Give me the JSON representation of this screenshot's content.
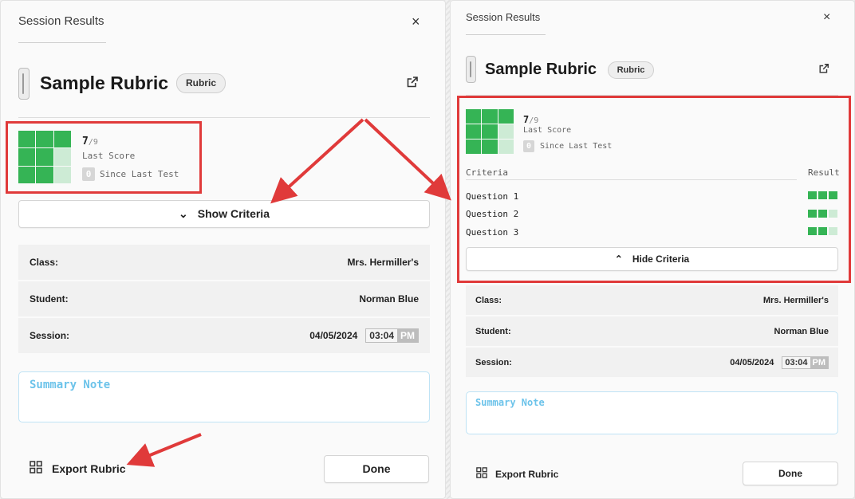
{
  "colors": {
    "green": "#35b455",
    "green_light": "#cdebd5",
    "annotation": "#e03a3a",
    "note_border": "#bfe3f5"
  },
  "left": {
    "header": {
      "title": "Session Results",
      "close_icon": "×"
    },
    "rubric": {
      "title": "Sample Rubric",
      "badge": "Rubric",
      "link_icon": "external-link-icon"
    },
    "score": {
      "value": "7",
      "max": "/9",
      "label": "Last Score",
      "since_value": "0",
      "since_label": "Since Last Test",
      "grid": [
        1,
        1,
        1,
        1,
        1,
        0,
        1,
        1,
        0
      ]
    },
    "show_criteria": {
      "icon": "⌄",
      "label": "Show Criteria"
    },
    "info": [
      {
        "label": "Class:",
        "value": "Mrs. Hermiller's"
      },
      {
        "label": "Student:",
        "value": "Norman Blue"
      }
    ],
    "session": {
      "label": "Session:",
      "date": "04/05/2024",
      "time": "03:04",
      "ampm": "PM"
    },
    "note_placeholder": "Summary Note",
    "export_label": "Export Rubric",
    "done_label": "Done"
  },
  "right": {
    "header": {
      "title": "Session Results",
      "close_icon": "×"
    },
    "rubric": {
      "title": "Sample Rubric",
      "badge": "Rubric",
      "link_icon": "external-link-icon"
    },
    "score": {
      "value": "7",
      "max": "/9",
      "label": "Last Score",
      "since_value": "0",
      "since_label": "Since Last Test",
      "grid": [
        1,
        1,
        1,
        1,
        1,
        0,
        1,
        1,
        0
      ]
    },
    "criteria": {
      "col_criteria": "Criteria",
      "col_result": "Result",
      "rows": [
        {
          "name": "Question 1",
          "result": [
            1,
            1,
            1
          ]
        },
        {
          "name": "Question 2",
          "result": [
            1,
            1,
            0
          ]
        },
        {
          "name": "Question 3",
          "result": [
            1,
            1,
            0
          ]
        }
      ]
    },
    "hide_criteria": {
      "icon": "⌃",
      "label": "Hide Criteria"
    },
    "info": [
      {
        "label": "Class:",
        "value": "Mrs. Hermiller's"
      },
      {
        "label": "Student:",
        "value": "Norman Blue"
      }
    ],
    "session": {
      "label": "Session:",
      "date": "04/05/2024",
      "time": "03:04",
      "ampm": "PM"
    },
    "note_placeholder": "Summary Note",
    "export_label": "Export Rubric",
    "done_label": "Done"
  }
}
